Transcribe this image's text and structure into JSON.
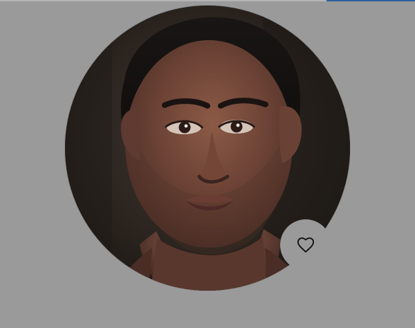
{
  "profile": {
    "favorite_icon": "heart-icon",
    "image_alt": ""
  }
}
